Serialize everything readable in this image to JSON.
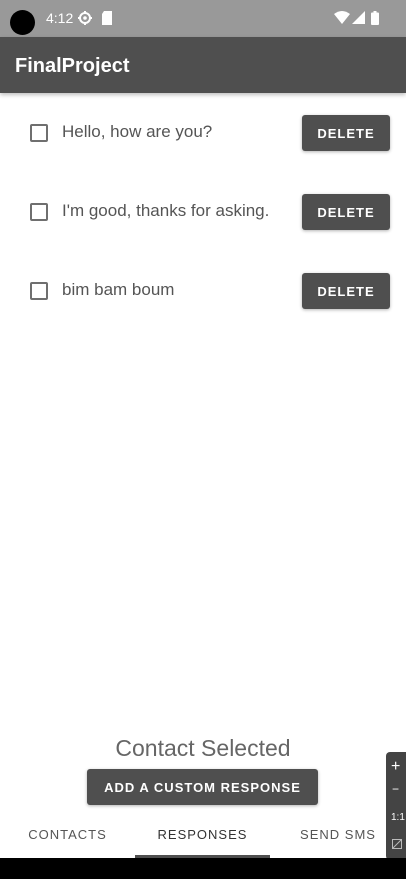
{
  "status_bar": {
    "time": "4:12",
    "icons_left": [
      "settings-gear-icon",
      "sd-card-icon"
    ],
    "icons_right": [
      "wifi-icon",
      "cell-signal-icon",
      "battery-icon"
    ]
  },
  "app_bar": {
    "title": "FinalProject",
    "color": "#4f4f4f"
  },
  "responses": [
    {
      "text": "Hello, how are you?",
      "checked": false,
      "delete_label": "DELETE"
    },
    {
      "text": "I'm good, thanks for asking.",
      "checked": false,
      "delete_label": "DELETE"
    },
    {
      "text": "bim bam boum",
      "checked": false,
      "delete_label": "DELETE"
    }
  ],
  "contact_selected": "Contact Selected",
  "add_button_label": "ADD A CUSTOM RESPONSE",
  "tabs": [
    {
      "label": "CONTACTS",
      "active": false
    },
    {
      "label": "RESPONSES",
      "active": true
    },
    {
      "label": "SEND SMS",
      "active": false
    }
  ],
  "zoom_panel": {
    "plus": "+",
    "minus": "−",
    "ratio": "1:1"
  }
}
